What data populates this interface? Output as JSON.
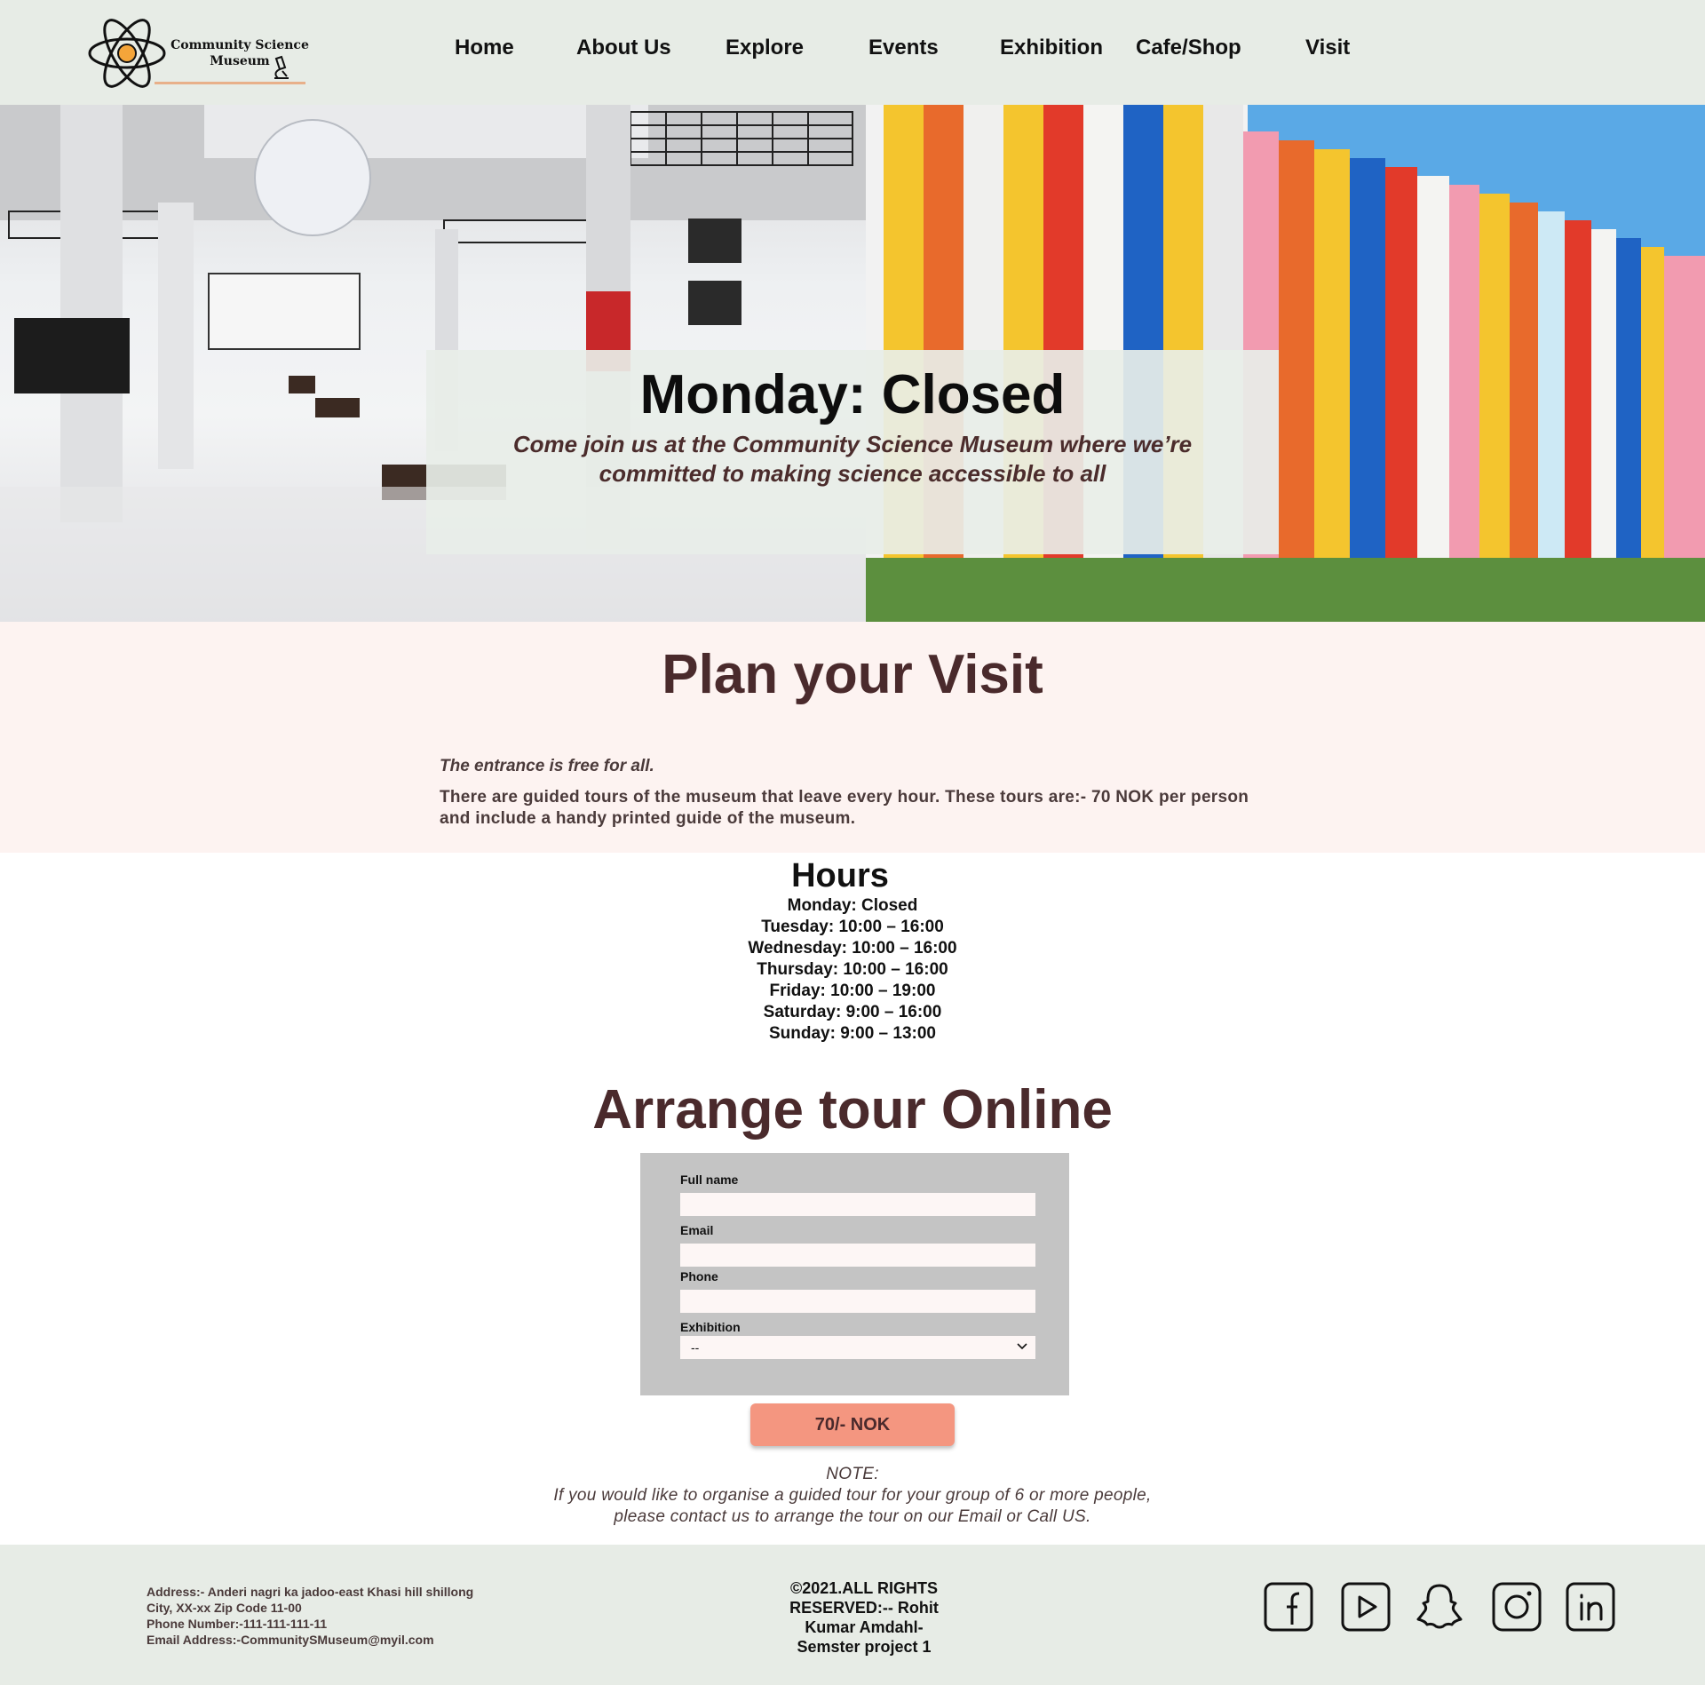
{
  "header": {
    "logo_text_line1": "Community Science",
    "logo_text_line2": "Museum",
    "nav": [
      "Home",
      "About  Us",
      "Explore",
      "Events",
      "Exhibition",
      "Cafe/Shop",
      "Visit"
    ]
  },
  "hero": {
    "title": "Monday: Closed",
    "subtitle": "Come join us at the Community Science Museum where we’re committed to making science accessible to all"
  },
  "plan": {
    "title": "Plan your Visit",
    "free_text": "The entrance is free for all.",
    "tours_text": "There are guided tours of the museum that leave every hour. These tours are:- 70 NOK per person and include a handy printed guide of the museum."
  },
  "hours": {
    "title": "Hours",
    "days": [
      "Monday: Closed",
      "Tuesday: 10:00 – 16:00",
      "Wednesday: 10:00 – 16:00",
      "Thursday: 10:00 – 16:00",
      "Friday: 10:00 – 19:00",
      "Saturday: 9:00 – 16:00",
      "Sunday: 9:00 – 13:00"
    ]
  },
  "arrange": {
    "title": "Arrange  tour Online",
    "form": {
      "full_name_label": "Full name",
      "full_name_value": "",
      "email_label": "Email",
      "email_value": "",
      "phone_label": "Phone",
      "phone_value": "",
      "exhibition_label": "Exhibition",
      "exhibition_selected": "--"
    },
    "pay_button": "70/- NOK",
    "note_title": "NOTE:",
    "note_line1": "If you would like to organise a guided tour for your group of 6 or more people,",
    "note_line2": "please contact us to arrange the tour on our Email or Call US."
  },
  "footer": {
    "address": "Address:- Anderi nagri ka jadoo-east Khasi hill shillong",
    "city": "City, XX-xx Zip Code 11-00",
    "phone": "Phone Number:-111-111-111-11",
    "email": "Email Address:-CommunitySMuseum@myil.com",
    "copyright_line1": "©2021.ALL RIGHTS",
    "copyright_line2": "RESERVED:-- Rohit",
    "copyright_line3": "Kumar Amdahl-",
    "copyright_line4": "Semster project 1",
    "social_icons": [
      "facebook-icon",
      "youtube-icon",
      "snapchat-icon",
      "instagram-icon",
      "linkedin-icon"
    ]
  },
  "colors": {
    "header_bg": "#e7ece6",
    "plan_bg": "#fdf3f1",
    "heading_brown": "#4a2a2c",
    "button": "#f49680",
    "form_bg": "#c4c4c4"
  }
}
